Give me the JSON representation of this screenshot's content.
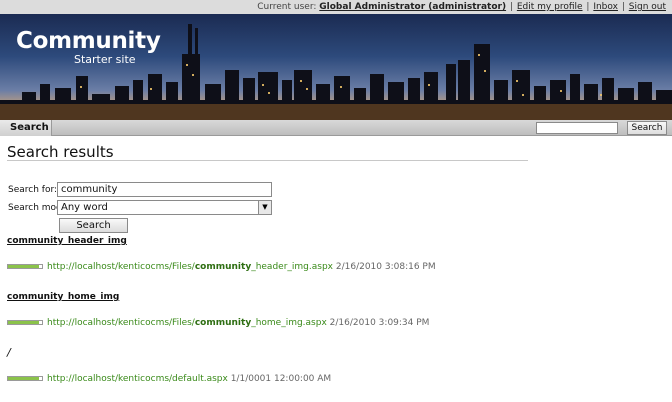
{
  "topbar": {
    "current_user_label": "Current user:",
    "user_name": "Global Administrator (administrator)",
    "links": [
      "Edit my profile",
      "Inbox",
      "Sign out"
    ]
  },
  "banner": {
    "title": "Community",
    "subtitle": "Starter site"
  },
  "nav": {
    "active_tab": "Search",
    "search_placeholder": "",
    "search_button": "Search"
  },
  "page": {
    "title": "Search results",
    "search_for_label": "Search for:",
    "search_for_value": "community",
    "search_mode_label": "Search mode:",
    "search_mode_value": "Any word",
    "search_button": "Search"
  },
  "results": [
    {
      "title": "community_header_img",
      "score": 0.9,
      "url_prefix": "http://localhost/kenticocms/Files/",
      "url_highlight": "community",
      "url_suffix": "_header_img.aspx",
      "date": "2/16/2010 3:08:16 PM"
    },
    {
      "title": "community_home_img",
      "score": 0.9,
      "url_prefix": "http://localhost/kenticocms/Files/",
      "url_highlight": "community",
      "url_suffix": "_home_img.aspx",
      "date": "2/16/2010 3:09:34 PM"
    },
    {
      "title": "/",
      "score": 0.9,
      "url_prefix": "http://localhost/kenticocms/default.aspx",
      "url_highlight": "",
      "url_suffix": "",
      "date": "1/1/0001 12:00:00 AM"
    }
  ],
  "colors": {
    "score_fill": "#8bc34a",
    "link_green": "#3a8a1a"
  }
}
